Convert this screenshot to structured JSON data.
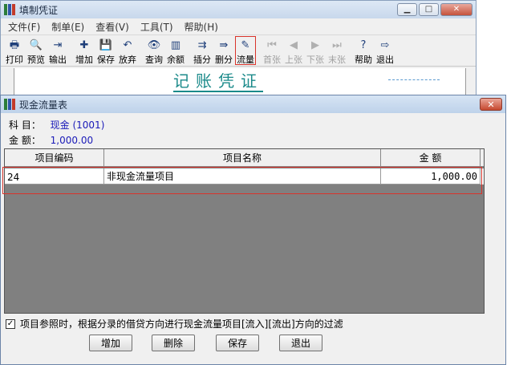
{
  "main_window": {
    "title": "填制凭证",
    "menu": [
      "文件(F)",
      "制单(E)",
      "查看(V)",
      "工具(T)",
      "帮助(H)"
    ],
    "toolbar": [
      {
        "label": "打印",
        "icon": "printer-icon",
        "glyph": "🖶",
        "disabled": false,
        "highlight": false
      },
      {
        "label": "预览",
        "icon": "preview-icon",
        "glyph": "🔍",
        "disabled": false,
        "highlight": false
      },
      {
        "label": "输出",
        "icon": "export-icon",
        "glyph": "⇥",
        "disabled": false,
        "highlight": false
      },
      {
        "label": "增加",
        "icon": "add-icon",
        "glyph": "✚",
        "disabled": false,
        "highlight": false
      },
      {
        "label": "保存",
        "icon": "save-icon",
        "glyph": "💾",
        "disabled": false,
        "highlight": false
      },
      {
        "label": "放弃",
        "icon": "undo-icon",
        "glyph": "↶",
        "disabled": false,
        "highlight": false
      },
      {
        "label": "查询",
        "icon": "binoculars-icon",
        "glyph": "👁",
        "disabled": false,
        "highlight": false
      },
      {
        "label": "余额",
        "icon": "balance-chart-icon",
        "glyph": "▥",
        "disabled": false,
        "highlight": false
      },
      {
        "label": "插分",
        "icon": "insert-entry-icon",
        "glyph": "⇉",
        "disabled": false,
        "highlight": false
      },
      {
        "label": "删分",
        "icon": "delete-entry-icon",
        "glyph": "⇛",
        "disabled": false,
        "highlight": false
      },
      {
        "label": "流量",
        "icon": "cash-flow-icon",
        "glyph": "✎",
        "disabled": false,
        "highlight": true
      },
      {
        "label": "首张",
        "icon": "first-icon",
        "glyph": "⏮",
        "disabled": true,
        "highlight": false
      },
      {
        "label": "上张",
        "icon": "prev-icon",
        "glyph": "◀",
        "disabled": true,
        "highlight": false
      },
      {
        "label": "下张",
        "icon": "next-icon",
        "glyph": "▶",
        "disabled": true,
        "highlight": false
      },
      {
        "label": "末张",
        "icon": "last-icon",
        "glyph": "⏭",
        "disabled": true,
        "highlight": false
      },
      {
        "label": "帮助",
        "icon": "help-icon",
        "glyph": "?",
        "disabled": false,
        "highlight": false
      },
      {
        "label": "退出",
        "icon": "exit-icon",
        "glyph": "⇨",
        "disabled": false,
        "highlight": false
      }
    ],
    "voucher_title": "记账凭证",
    "window_controls": {
      "minimize": "▁",
      "maximize": "□",
      "close": "✕"
    }
  },
  "dialog": {
    "title": "现金流量表",
    "close_glyph": "✕",
    "subject_label": "科  目：",
    "subject_value": "现金 (1001)",
    "amount_label": "金  额：",
    "amount_value": "1,000.00",
    "columns": [
      "项目编码",
      "项目名称",
      "金  额"
    ],
    "rows": [
      {
        "code": "24",
        "name": "非现金流量项目",
        "amount": "1,000.00"
      }
    ],
    "filter_checked": true,
    "filter_check_glyph": "✓",
    "filter_label": "项目参照时，根据分录的借贷方向进行现金流量项目[流入][流出]方向的过滤",
    "buttons": [
      "增加",
      "删除",
      "保存",
      "退出"
    ]
  },
  "colors": {
    "highlight_red": "#d9342b",
    "voucher_title": "#1b8a8a",
    "info_value_blue": "#1a1ab8",
    "grid_empty": "#808080"
  }
}
